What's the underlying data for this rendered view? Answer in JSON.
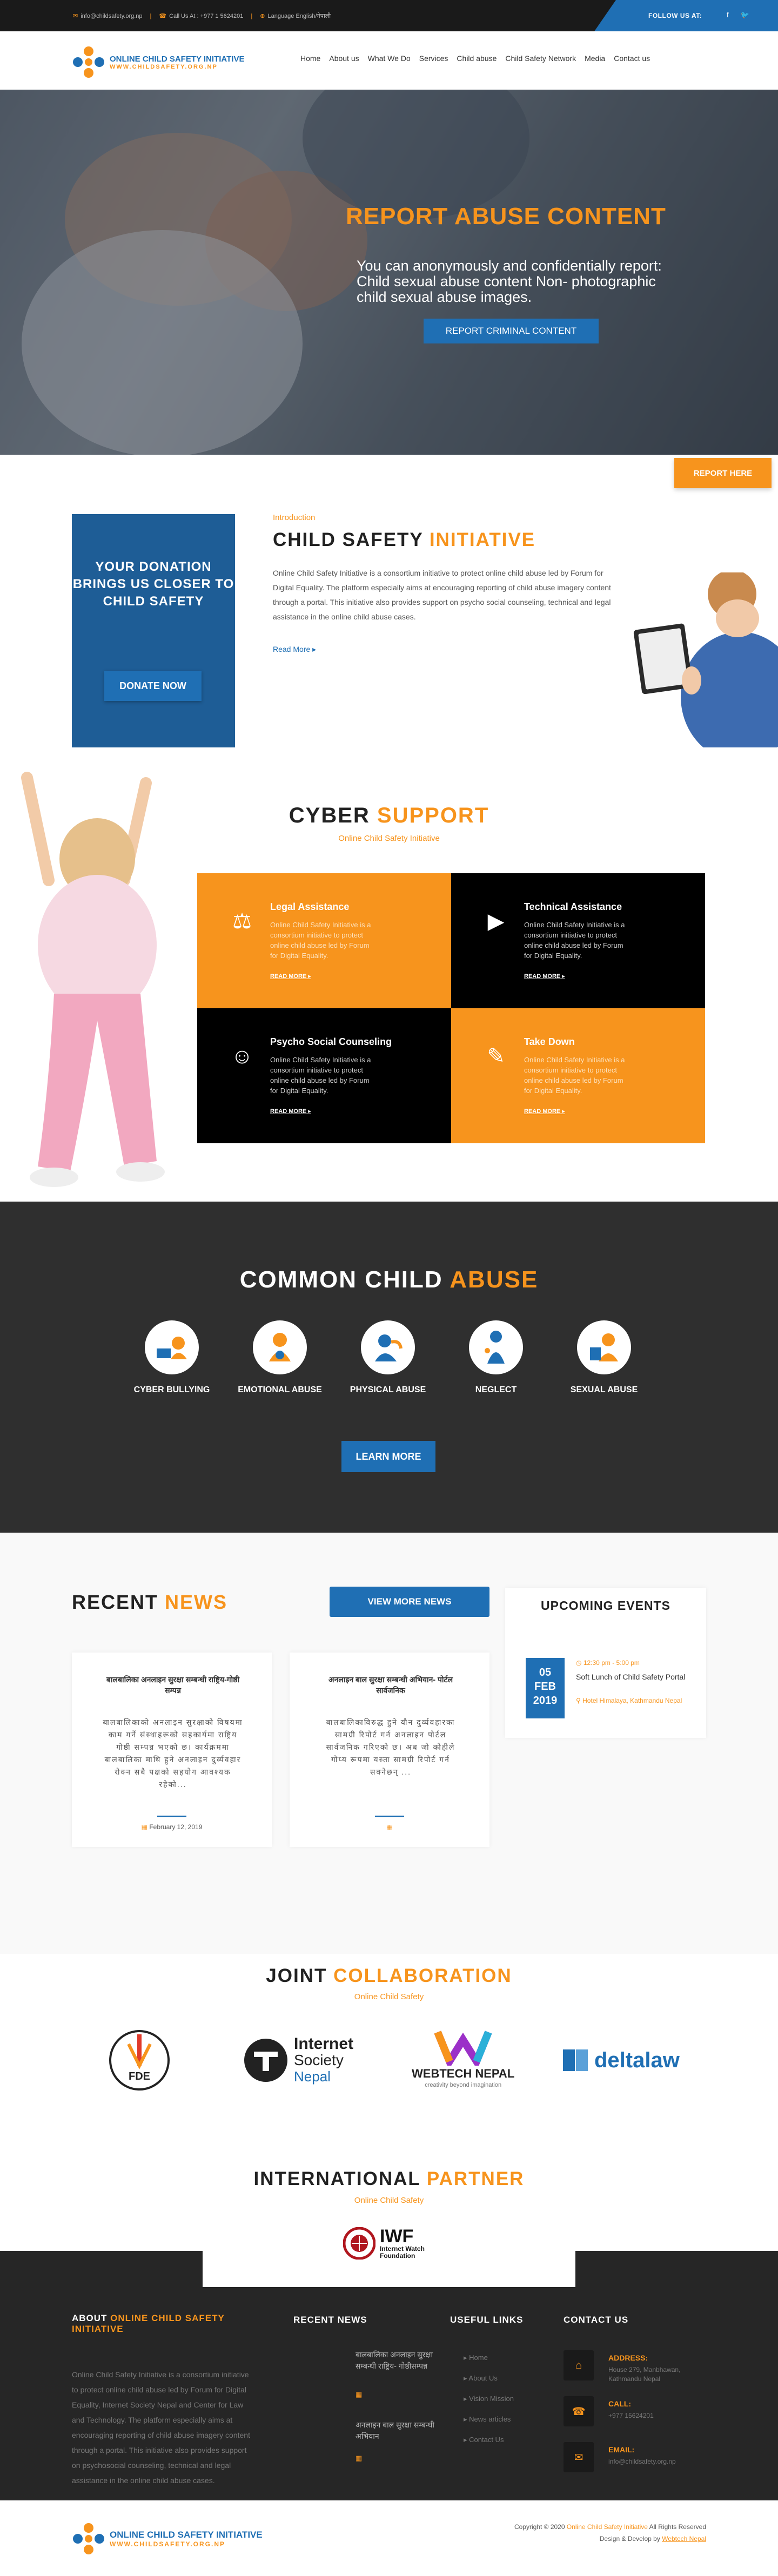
{
  "topbar": {
    "email": "info@childsafety.org.np",
    "call": "Call Us At : +977 1 5624201",
    "language": "Language English/नेपाली",
    "follow": "FOLLOW US AT:"
  },
  "logo": {
    "title": "ONLINE CHILD SAFETY INITIATIVE",
    "subtitle": "WWW.CHILDSAFETY.ORG.NP"
  },
  "nav": [
    "Home",
    "About us",
    "What We Do",
    "Services",
    "Child abuse",
    "Child Safety Network",
    "Media",
    "Contact us"
  ],
  "hero": {
    "title": "REPORT ABUSE CONTENT",
    "text": "You can anonymously and confidentially report: Child sexual abuse content Non- photographic child sexual abuse images.",
    "button": "REPORT CRIMINAL CONTENT"
  },
  "report_here": "REPORT HERE",
  "donate": {
    "text": "YOUR DONATION BRINGS US CLOSER TO CHILD SAFETY",
    "button": "DONATE NOW"
  },
  "intro": {
    "kicker": "Introduction",
    "title_a": "CHILD SAFETY ",
    "title_b": "INITIATIVE",
    "text": "Online Child Safety Initiative is a consortium initiative to protect online child abuse led by Forum for Digital Equality. The platform especially aims at encouraging reporting of child abuse imagery content through a portal. This initiative also provides support on psycho social counseling, technical and legal assistance in the online child abuse cases.",
    "read_more": "Read More"
  },
  "cyber": {
    "title_a": "CYBER ",
    "title_b": "SUPPORT",
    "subtitle": "Online Child Safety Initiative",
    "cards": [
      {
        "title": "Legal Assistance",
        "text": "Online Child Safety Initiative is a consortium initiative to protect online child abuse led by Forum for Digital Equality.",
        "link": "READ MORE"
      },
      {
        "title": "Technical Assistance",
        "text": "Online Child Safety Initiative is a consortium initiative to protect online child abuse led by Forum for Digital Equality.",
        "link": "READ MORE"
      },
      {
        "title": "Psycho Social Counseling",
        "text": "Online Child Safety Initiative is a consortium initiative to protect online child abuse led by Forum for Digital Equality.",
        "link": "READ MORE"
      },
      {
        "title": "Take Down",
        "text": "Online Child Safety Initiative is a consortium initiative to protect online child abuse led by Forum for Digital Equality.",
        "link": "READ MORE"
      }
    ]
  },
  "common": {
    "title_a": "COMMON CHILD ",
    "title_b": "ABUSE",
    "items": [
      "CYBER BULLYING",
      "EMOTIONAL ABUSE",
      "PHYSICAL ABUSE",
      "NEGLECT",
      "SEXUAL ABUSE"
    ],
    "button": "LEARN MORE"
  },
  "news": {
    "title_a": "RECENT ",
    "title_b": "NEWS",
    "view_more": "VIEW MORE NEWS",
    "cards": [
      {
        "title": "बालबालिका अनलाइन सुरक्षा सम्बन्धी राष्ट्रिय-गोष्ठी सम्पन्न",
        "text": "बालबालिकाको अनलाइन सुरक्षाको विषयमा काम गर्ने संस्थाहरूको सहकार्यमा राष्ट्रिय गोष्ठी सम्पन्न भएको छ। कार्यक्रममा बालबालिका माथि हुने अनलाइन दुर्व्यवहार रोक्न सबै पक्षको सहयोग आवश्यक रहेको...",
        "date": "February 12, 2019"
      },
      {
        "title": "अनलाइन बाल सुरक्षा सम्बन्धी अभियान- पोर्टल सार्वजनिक",
        "text": "बालबालिकाविरुद्ध हुने यौन दुर्व्यवहारका सामग्री रिपोर्ट गर्न अनलाइन पोर्टल सार्वजनिक गरिएको छ। अब जो कोहीले गोप्य रूपमा यस्ता सामग्री रिपोर्ट गर्न सक्नेछन् ...",
        "date": ""
      }
    ]
  },
  "upcoming": {
    "title": "UPCOMING EVENTS",
    "day": "05",
    "month": "FEB",
    "year": "2019",
    "time": "12:30 pm - 5:00 pm",
    "event_title": "Soft Lunch of Child Safety Portal",
    "location": "Hotel Himalaya, Kathmandu Nepal"
  },
  "joint": {
    "title_a": "JOINT ",
    "title_b": "COLLABORATION",
    "subtitle": "Online Child Safety"
  },
  "partners": {
    "fde": "FDE",
    "isoc_a": "Internet",
    "isoc_b": "Society",
    "isoc_c": "Nepal",
    "webtech": "WEBTECH NEPAL",
    "webtech_sub": "creativity beyond imagination",
    "delta": "deltalaw"
  },
  "intl": {
    "title_a": "INTERNATIONAL ",
    "title_b": "PARTNER",
    "subtitle": "Online Child Safety",
    "iwf": "IWF",
    "iwf_sub": "Internet Watch Foundation"
  },
  "footer": {
    "about_title_a": "ABOUT ",
    "about_title_b": "ONLINE CHILD SAFETY INITIATIVE",
    "about_text": "Online Child Safety Initiative is a consortium initiative to protect online child abuse led by Forum for Digital Equality, Internet Society Nepal and Center for Law and Technology. The platform especially aims at encouraging reporting of child abuse imagery content through a portal. This initiative also provides support on psychosocial counseling, technical and legal assistance in the online child abuse cases.",
    "news_title": "RECENT NEWS",
    "news": [
      "बालबालिका अनलाइन सुरक्षा सम्बन्धी राष्ट्रिय- गोष्ठीसम्पन्न",
      "अनलाइन बाल सुरक्षा सम्बन्धी अभियान"
    ],
    "links_title": "USEFUL LINKS",
    "links": [
      "Home",
      "About Us",
      "Vision Mission",
      "News articles",
      "Contact Us"
    ],
    "contact_title": "CONTACT US",
    "address_label": "ADDRESS:",
    "address": "House 279, Manbhawan, Kathmandu Nepal",
    "call_label": "CALL:",
    "call": "+977 15624201",
    "email_label": "EMAIL:",
    "email": "info@childsafety.org.np"
  },
  "bottom": {
    "copyright_a": "Copyright © 2020 ",
    "copyright_b": "Online Child Safety Initiative",
    "copyright_c": " All Rights Reserved",
    "design_a": "Design & Develop by ",
    "design_b": "Webtech Nepal"
  },
  "colors": {
    "accent": "#f7941d",
    "brand": "#1f6fb4",
    "dark": "#2f2f2f"
  }
}
